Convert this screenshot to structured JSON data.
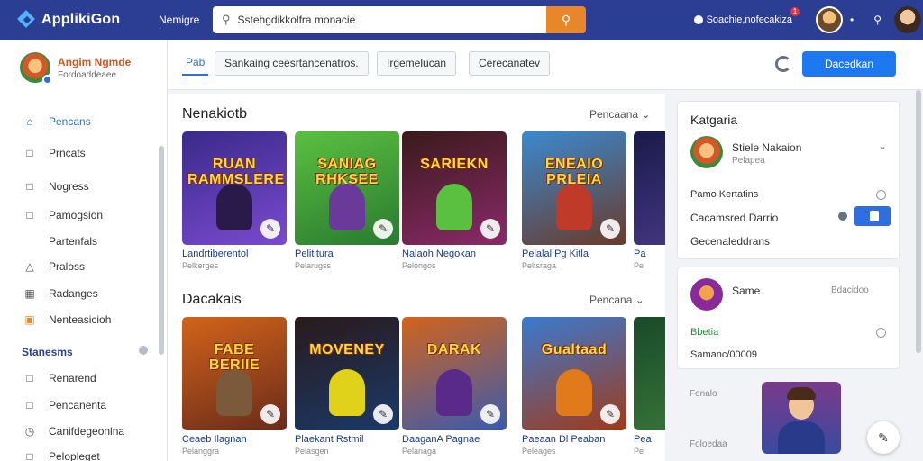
{
  "topbar": {
    "app_name": "ApplikiGon",
    "nav_label": "Nemigre",
    "search_value": "Sstehgdikkolfra monacie",
    "notification_label": "Soachie,nofecakiza",
    "notification_count": "1",
    "separator": "•"
  },
  "sidebar": {
    "profile_name": "Angim Ngmde",
    "profile_sub": "Fordoaddeaee",
    "items": [
      {
        "label": "Pencans",
        "icon": "home-icon"
      },
      {
        "label": "Prncats",
        "icon": "document-icon"
      },
      {
        "label": "Nogress",
        "icon": "document-icon"
      },
      {
        "label": "Pamogsion",
        "icon": "document-icon"
      },
      {
        "label": "Partenfals",
        "icon": ""
      },
      {
        "label": "Praloss",
        "icon": "triangle-icon"
      },
      {
        "label": "Radanges",
        "icon": "grid-icon"
      },
      {
        "label": "Nenteasicioh",
        "icon": "flag-icon"
      }
    ],
    "section_heading": "Stanesms",
    "section_items": [
      {
        "label": "Renarend",
        "icon": "document-icon"
      },
      {
        "label": "Pencanenta",
        "icon": "document-icon"
      },
      {
        "label": "Canifdegeonlna",
        "icon": "clock-icon"
      },
      {
        "label": "Pelopleget",
        "icon": "chat-icon"
      }
    ]
  },
  "toolbar": {
    "tabs": [
      "Pab",
      "Sankaing ceesrtancenatros.",
      "Irgemelucan",
      "Cerecanatev"
    ],
    "primary_button": "Dacedkan"
  },
  "sections": [
    {
      "title": "Nenakiotb",
      "more": "Pencaana",
      "cards": [
        {
          "art": "RUAN RAMMSLERE",
          "title": "Landrtiberentol",
          "sub": "Pelkerges",
          "c1": "#3a2a8a",
          "c2": "#7a4ad0",
          "fig": "#2a1a4a"
        },
        {
          "art": "SANIAG RHKSEE",
          "title": "Pelititura",
          "sub": "Pelarugss",
          "c1": "#5ac040",
          "c2": "#2a7a30",
          "fig": "#6a3a9a"
        },
        {
          "art": "SARIEKN",
          "title": "Nalaoh Negokan",
          "sub": "Pelongos",
          "c1": "#3a1a1a",
          "c2": "#8a2a6a",
          "fig": "#5ac040"
        },
        {
          "art": "ENEAIO PRLEIA",
          "title": "Pelalal Pg Kitla",
          "sub": "Peltsraga",
          "c1": "#3a8ad0",
          "c2": "#6a3a2a",
          "fig": "#c03a2a"
        },
        {
          "art": "",
          "title": "Pa",
          "sub": "Pe",
          "c1": "#1a1a4a",
          "c2": "#4a3a8a",
          "fig": "#2a2a2a"
        }
      ]
    },
    {
      "title": "Dacakais",
      "more": "Pencana",
      "cards": [
        {
          "art": "FABE BERIIE",
          "title": "Ceaeb Ilagnan",
          "sub": "Pelanggra",
          "c1": "#d2641a",
          "c2": "#6a2a1a",
          "fig": "#7a5a3a"
        },
        {
          "art": "MOVENEY",
          "title": "Plaekant Rstmil",
          "sub": "Pelasgen",
          "c1": "#2a1a1a",
          "c2": "#1a3a6a",
          "fig": "#e0d21a"
        },
        {
          "art": "DARAK",
          "title": "DaaganA Pagnae",
          "sub": "Pelanaga",
          "c1": "#d2641a",
          "c2": "#3a5ab0",
          "fig": "#5a2a8a"
        },
        {
          "art": "Gualtaad",
          "title": "Paeaan Dl Peaban",
          "sub": "Peleages",
          "c1": "#3a7ad0",
          "c2": "#a03a1a",
          "fig": "#e07a1a"
        },
        {
          "art": "",
          "title": "Pea",
          "sub": "Pe",
          "c1": "#1a4a2a",
          "c2": "#3a7a3a",
          "fig": "#c0a01a"
        }
      ]
    }
  ],
  "panel": {
    "title": "Katgaria",
    "user_name": "Stiele Nakaion",
    "user_sub": "Pelapea",
    "row1_label": "Pamo Kertatins",
    "row2_label": "Cacamsred Darrio",
    "row3_label": "Gecenaleddrans"
  },
  "panel2": {
    "title": "Same",
    "title_right": "Bdacidoo",
    "row1_label": "Bbetia",
    "row2_label": "Samanc/00009"
  },
  "lower": {
    "label1": "Fonalo",
    "label2": "Foloedaa"
  },
  "icons": {
    "search": "search-icon",
    "refresh": "refresh-icon",
    "fab": "edit-icon"
  },
  "colors": {
    "topbar": "#2c3e94",
    "accent": "#2f6ee0",
    "search_button": "#e8862a"
  }
}
